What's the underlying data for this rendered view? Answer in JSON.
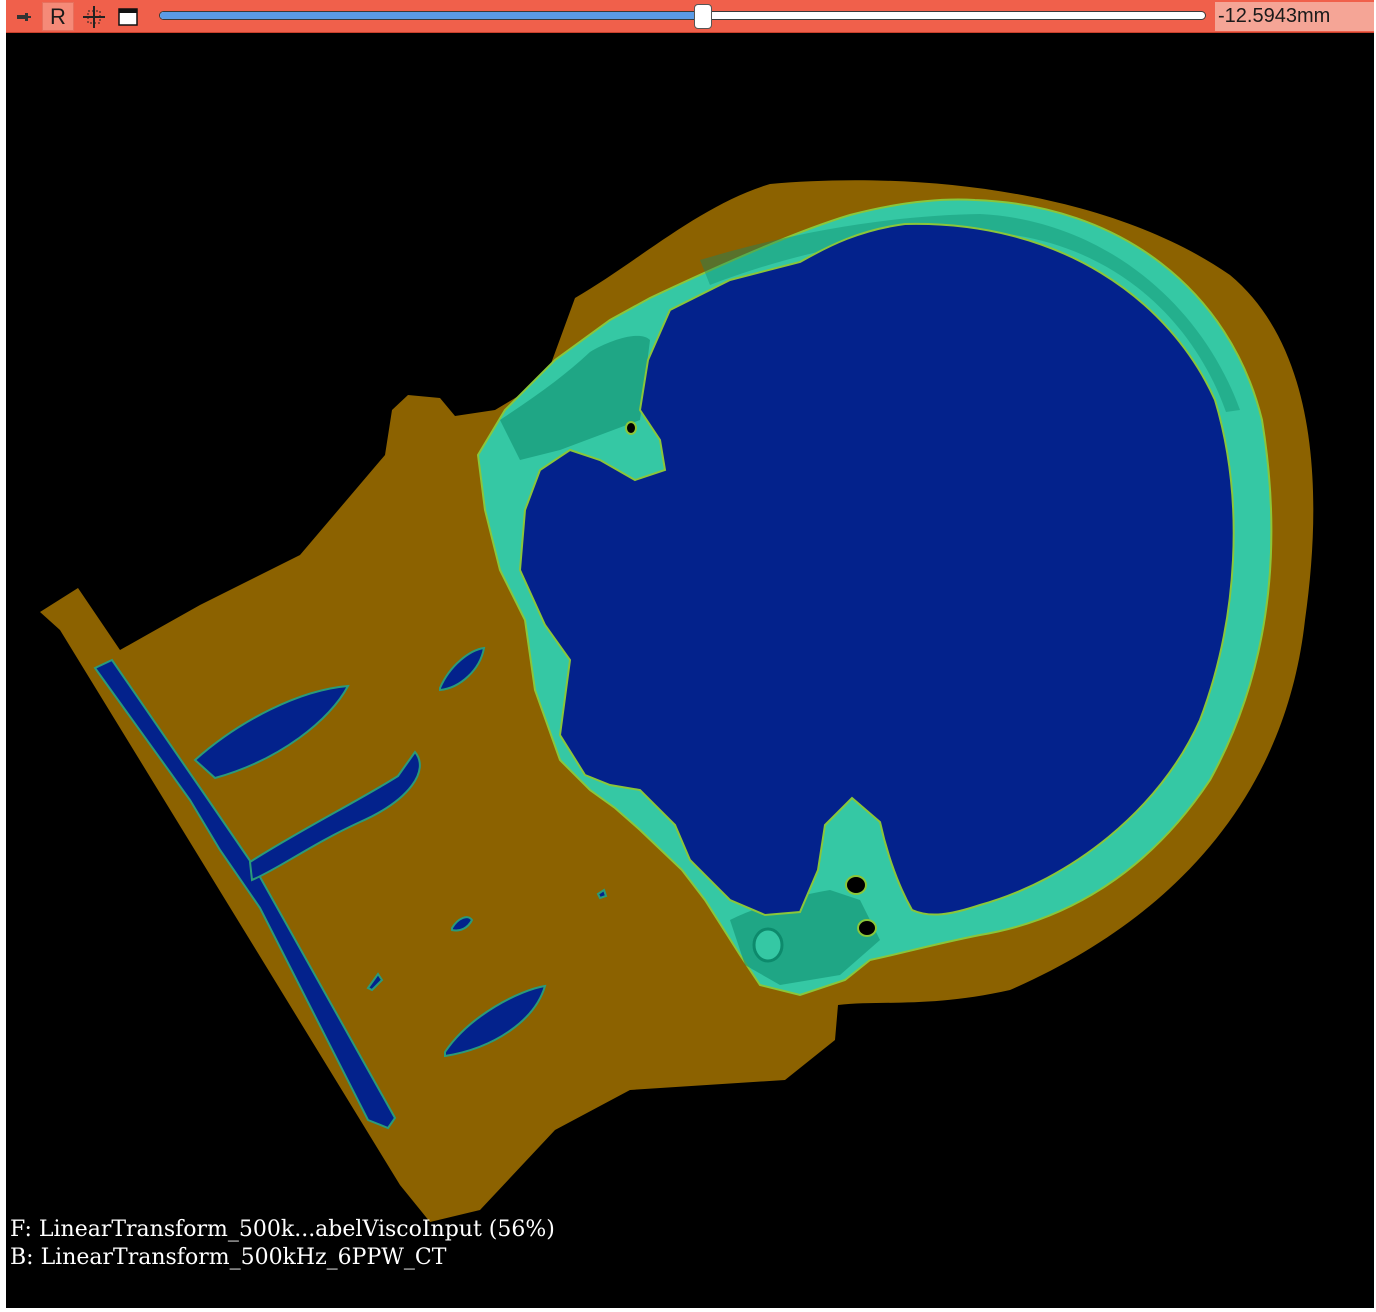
{
  "toolbar": {
    "pin_icon": "pin-icon",
    "reformat_label": "R",
    "crosshair_icon": "crosshair-icon",
    "view_icon": "view-controls-icon",
    "slice_slider_position": 0.52,
    "slice_offset": "-12.5943mm",
    "color": "#f0604b"
  },
  "viewer": {
    "background": "#000000",
    "foreground_label": "F: LinearTransform_500k...abelViscoInput (56%)",
    "background_label": "B: LinearTransform_500kHz_6PPW_CT"
  },
  "colors": {
    "tissue": "#8c6200",
    "brain": "#03228c",
    "skull": "#35c8a4",
    "skull_dark": "#0d8a6c"
  }
}
